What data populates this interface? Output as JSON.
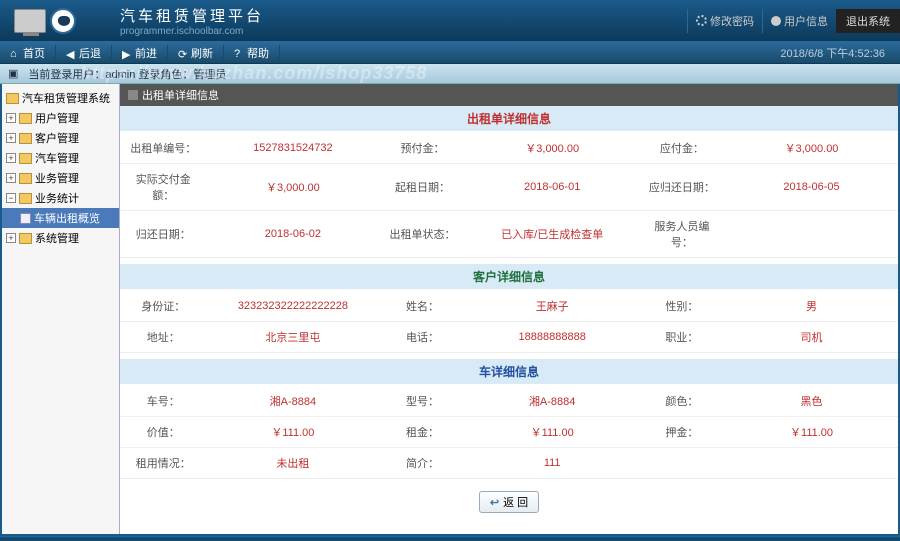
{
  "header": {
    "title": "汽车租赁管理平台",
    "subtitle": "programmer.ischoolbar.com",
    "links": {
      "modify_pwd": "修改密码",
      "user_info": "用户信息",
      "exit": "退出系统"
    }
  },
  "nav": {
    "items": [
      "首页",
      "后退",
      "前进",
      "刷新",
      "帮助"
    ],
    "datetime": "2018/6/8 下午4:52:36"
  },
  "breadcrumb": {
    "watermark": "https://www.huzhan.com/ishop33758",
    "text": "当前登录用户：admin  登录角色：管理员"
  },
  "tree": {
    "root": "汽车租赁管理系统",
    "nodes": [
      {
        "label": "用户管理",
        "expanded": false
      },
      {
        "label": "客户管理",
        "expanded": false
      },
      {
        "label": "汽车管理",
        "expanded": false
      },
      {
        "label": "业务管理",
        "expanded": false
      },
      {
        "label": "业务统计",
        "expanded": true,
        "children": [
          {
            "label": "车辆出租概览",
            "selected": true
          }
        ]
      },
      {
        "label": "系统管理",
        "expanded": false
      }
    ]
  },
  "content": {
    "panel_title": "出租单详细信息",
    "sections": [
      {
        "title": "出租单详细信息",
        "cls": "t1",
        "rows": [
          [
            {
              "l": "出租单编号：",
              "v": "1527831524732"
            },
            {
              "l": "预付金：",
              "v": "￥3,000.00"
            },
            {
              "l": "应付金：",
              "v": "￥3,000.00"
            }
          ],
          [
            {
              "l": "实际交付金额：",
              "v": "￥3,000.00"
            },
            {
              "l": "起租日期：",
              "v": "2018-06-01"
            },
            {
              "l": "应归还日期：",
              "v": "2018-06-05"
            }
          ],
          [
            {
              "l": "归还日期：",
              "v": "2018-06-02"
            },
            {
              "l": "出租单状态：",
              "v": "已入库/已生成检查单"
            },
            {
              "l": "服务人员编号：",
              "v": ""
            }
          ]
        ]
      },
      {
        "title": "客户详细信息",
        "cls": "t2",
        "rows": [
          [
            {
              "l": "身份证：",
              "v": "323232322222222228"
            },
            {
              "l": "姓名：",
              "v": "王麻子"
            },
            {
              "l": "性别：",
              "v": "男"
            }
          ],
          [
            {
              "l": "地址：",
              "v": "北京三里屯"
            },
            {
              "l": "电话：",
              "v": "18888888888"
            },
            {
              "l": "职业：",
              "v": "司机"
            }
          ]
        ]
      },
      {
        "title": "车详细信息",
        "cls": "t3",
        "rows": [
          [
            {
              "l": "车号：",
              "v": "湘A-8884"
            },
            {
              "l": "型号：",
              "v": "湘A-8884"
            },
            {
              "l": "颜色：",
              "v": "黑色"
            }
          ],
          [
            {
              "l": "价值：",
              "v": "￥111.00"
            },
            {
              "l": "租金：",
              "v": "￥111.00"
            },
            {
              "l": "押金：",
              "v": "￥111.00"
            }
          ],
          [
            {
              "l": "租用情况：",
              "v": "未出租"
            },
            {
              "l": "简介：",
              "v": "111"
            },
            {
              "l": "",
              "v": ""
            }
          ]
        ]
      }
    ],
    "back_btn": "返 回"
  }
}
